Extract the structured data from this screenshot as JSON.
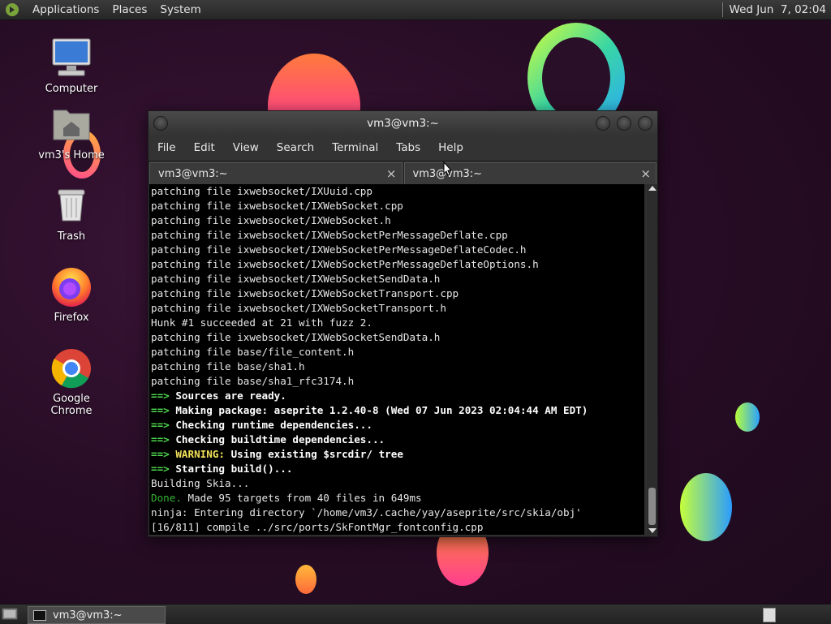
{
  "top_panel": {
    "menus": [
      "Applications",
      "Places",
      "System"
    ],
    "clock": "Wed Jun  7, 02:04"
  },
  "desktop_icons": [
    {
      "label": "Computer",
      "icon": "computer-icon"
    },
    {
      "label": "vm3's Home",
      "icon": "home-folder-icon"
    },
    {
      "label": "Trash",
      "icon": "trash-icon"
    },
    {
      "label": "Firefox",
      "icon": "firefox-icon"
    },
    {
      "label": "Google Chrome",
      "icon": "chrome-icon"
    }
  ],
  "terminal_window": {
    "title": "vm3@vm3:~",
    "menu": [
      "File",
      "Edit",
      "View",
      "Search",
      "Terminal",
      "Tabs",
      "Help"
    ],
    "tabs": [
      {
        "label": "vm3@vm3:~",
        "close": "×"
      },
      {
        "label": "vm3@vm3:~",
        "close": "×"
      }
    ],
    "lines": [
      {
        "text": "patching file ixwebsocket/IXUuid.cpp"
      },
      {
        "text": "patching file ixwebsocket/IXWebSocket.cpp"
      },
      {
        "text": "patching file ixwebsocket/IXWebSocket.h"
      },
      {
        "text": "patching file ixwebsocket/IXWebSocketPerMessageDeflate.cpp"
      },
      {
        "text": "patching file ixwebsocket/IXWebSocketPerMessageDeflateCodec.h"
      },
      {
        "text": "patching file ixwebsocket/IXWebSocketPerMessageDeflateOptions.h"
      },
      {
        "text": "patching file ixwebsocket/IXWebSocketSendData.h"
      },
      {
        "text": "patching file ixwebsocket/IXWebSocketTransport.cpp"
      },
      {
        "text": "patching file ixwebsocket/IXWebSocketTransport.h"
      },
      {
        "text": "Hunk #1 succeeded at 21 with fuzz 2."
      },
      {
        "text": "patching file ixwebsocket/IXWebSocketSendData.h"
      },
      {
        "text": "patching file base/file_content.h"
      },
      {
        "text": "patching file base/sha1.h"
      },
      {
        "text": "patching file base/sha1_rfc3174.h"
      },
      {
        "prefix": "==> ",
        "text": "Sources are ready.",
        "style": "bold"
      },
      {
        "prefix": "==> ",
        "text": "Making package: aseprite 1.2.40-8 (Wed 07 Jun 2023 02:04:44 AM EDT)",
        "style": "bold"
      },
      {
        "prefix": "==> ",
        "text": "Checking runtime dependencies...",
        "style": "bold"
      },
      {
        "prefix": "==> ",
        "text": "Checking buildtime dependencies...",
        "style": "bold"
      },
      {
        "prefix": "==> ",
        "warn": "WARNING:",
        "text": " Using existing $srcdir/ tree",
        "style": "bold"
      },
      {
        "prefix": "==> ",
        "text": "Starting build()...",
        "style": "bold"
      },
      {
        "text": "Building Skia..."
      },
      {
        "done": "Done.",
        "text": " Made 95 targets from 40 files in 649ms"
      },
      {
        "text": "ninja: Entering directory `/home/vm3/.cache/yay/aseprite/src/skia/obj'"
      },
      {
        "text": "[16/811] compile ../src/ports/SkFontMgr_fontconfig.cpp"
      }
    ]
  },
  "bottom_panel": {
    "task_label": "vm3@vm3:~"
  }
}
